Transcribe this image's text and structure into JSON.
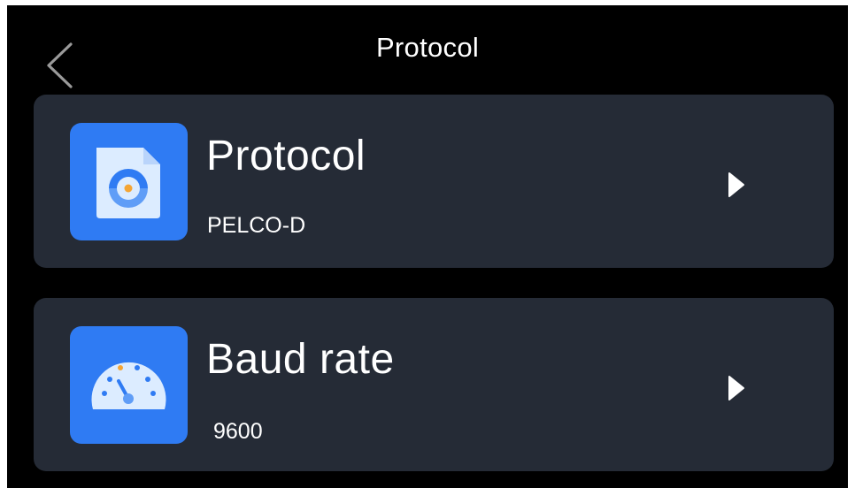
{
  "header": {
    "title": "Protocol",
    "back_icon": "chevron-left-icon"
  },
  "settings": [
    {
      "label": "Protocol",
      "value": "PELCO-D",
      "icon": "protocol-document-icon",
      "arrow_icon": "caret-right-icon"
    },
    {
      "label": "Baud rate",
      "value": "9600",
      "icon": "speedometer-icon",
      "arrow_icon": "caret-right-icon"
    }
  ],
  "colors": {
    "background": "#000000",
    "card": "#252b36",
    "icon_tile": "#2f7bf3",
    "text": "#ffffff"
  }
}
